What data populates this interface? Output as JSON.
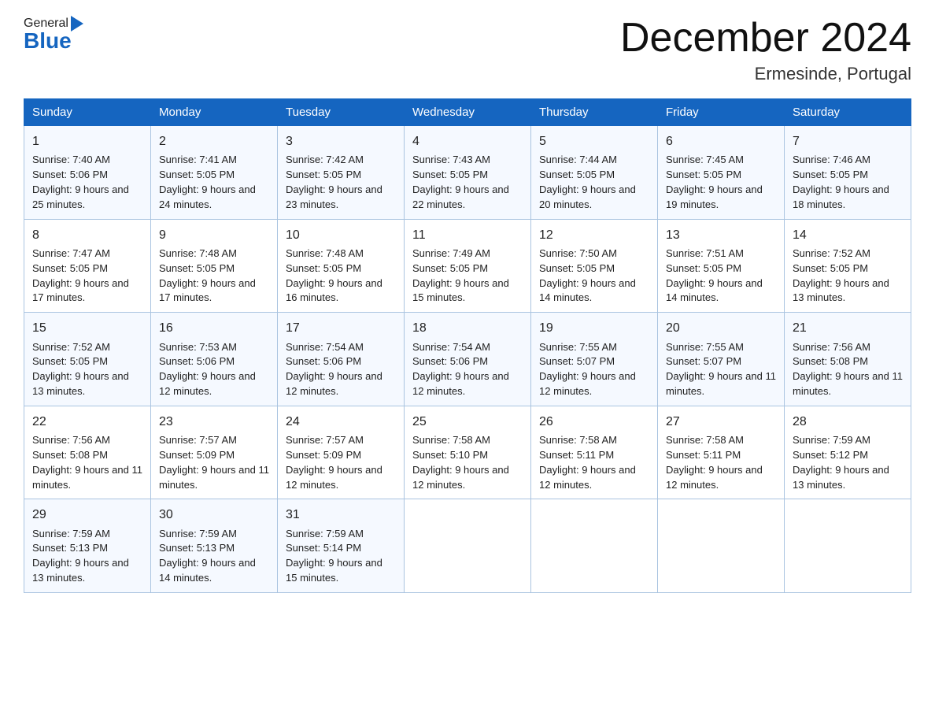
{
  "header": {
    "logo_general": "General",
    "logo_blue": "Blue",
    "month_title": "December 2024",
    "location": "Ermesinde, Portugal"
  },
  "days_of_week": [
    "Sunday",
    "Monday",
    "Tuesday",
    "Wednesday",
    "Thursday",
    "Friday",
    "Saturday"
  ],
  "weeks": [
    [
      {
        "day": "1",
        "sunrise": "7:40 AM",
        "sunset": "5:06 PM",
        "daylight": "9 hours and 25 minutes."
      },
      {
        "day": "2",
        "sunrise": "7:41 AM",
        "sunset": "5:05 PM",
        "daylight": "9 hours and 24 minutes."
      },
      {
        "day": "3",
        "sunrise": "7:42 AM",
        "sunset": "5:05 PM",
        "daylight": "9 hours and 23 minutes."
      },
      {
        "day": "4",
        "sunrise": "7:43 AM",
        "sunset": "5:05 PM",
        "daylight": "9 hours and 22 minutes."
      },
      {
        "day": "5",
        "sunrise": "7:44 AM",
        "sunset": "5:05 PM",
        "daylight": "9 hours and 20 minutes."
      },
      {
        "day": "6",
        "sunrise": "7:45 AM",
        "sunset": "5:05 PM",
        "daylight": "9 hours and 19 minutes."
      },
      {
        "day": "7",
        "sunrise": "7:46 AM",
        "sunset": "5:05 PM",
        "daylight": "9 hours and 18 minutes."
      }
    ],
    [
      {
        "day": "8",
        "sunrise": "7:47 AM",
        "sunset": "5:05 PM",
        "daylight": "9 hours and 17 minutes."
      },
      {
        "day": "9",
        "sunrise": "7:48 AM",
        "sunset": "5:05 PM",
        "daylight": "9 hours and 17 minutes."
      },
      {
        "day": "10",
        "sunrise": "7:48 AM",
        "sunset": "5:05 PM",
        "daylight": "9 hours and 16 minutes."
      },
      {
        "day": "11",
        "sunrise": "7:49 AM",
        "sunset": "5:05 PM",
        "daylight": "9 hours and 15 minutes."
      },
      {
        "day": "12",
        "sunrise": "7:50 AM",
        "sunset": "5:05 PM",
        "daylight": "9 hours and 14 minutes."
      },
      {
        "day": "13",
        "sunrise": "7:51 AM",
        "sunset": "5:05 PM",
        "daylight": "9 hours and 14 minutes."
      },
      {
        "day": "14",
        "sunrise": "7:52 AM",
        "sunset": "5:05 PM",
        "daylight": "9 hours and 13 minutes."
      }
    ],
    [
      {
        "day": "15",
        "sunrise": "7:52 AM",
        "sunset": "5:05 PM",
        "daylight": "9 hours and 13 minutes."
      },
      {
        "day": "16",
        "sunrise": "7:53 AM",
        "sunset": "5:06 PM",
        "daylight": "9 hours and 12 minutes."
      },
      {
        "day": "17",
        "sunrise": "7:54 AM",
        "sunset": "5:06 PM",
        "daylight": "9 hours and 12 minutes."
      },
      {
        "day": "18",
        "sunrise": "7:54 AM",
        "sunset": "5:06 PM",
        "daylight": "9 hours and 12 minutes."
      },
      {
        "day": "19",
        "sunrise": "7:55 AM",
        "sunset": "5:07 PM",
        "daylight": "9 hours and 12 minutes."
      },
      {
        "day": "20",
        "sunrise": "7:55 AM",
        "sunset": "5:07 PM",
        "daylight": "9 hours and 11 minutes."
      },
      {
        "day": "21",
        "sunrise": "7:56 AM",
        "sunset": "5:08 PM",
        "daylight": "9 hours and 11 minutes."
      }
    ],
    [
      {
        "day": "22",
        "sunrise": "7:56 AM",
        "sunset": "5:08 PM",
        "daylight": "9 hours and 11 minutes."
      },
      {
        "day": "23",
        "sunrise": "7:57 AM",
        "sunset": "5:09 PM",
        "daylight": "9 hours and 11 minutes."
      },
      {
        "day": "24",
        "sunrise": "7:57 AM",
        "sunset": "5:09 PM",
        "daylight": "9 hours and 12 minutes."
      },
      {
        "day": "25",
        "sunrise": "7:58 AM",
        "sunset": "5:10 PM",
        "daylight": "9 hours and 12 minutes."
      },
      {
        "day": "26",
        "sunrise": "7:58 AM",
        "sunset": "5:11 PM",
        "daylight": "9 hours and 12 minutes."
      },
      {
        "day": "27",
        "sunrise": "7:58 AM",
        "sunset": "5:11 PM",
        "daylight": "9 hours and 12 minutes."
      },
      {
        "day": "28",
        "sunrise": "7:59 AM",
        "sunset": "5:12 PM",
        "daylight": "9 hours and 13 minutes."
      }
    ],
    [
      {
        "day": "29",
        "sunrise": "7:59 AM",
        "sunset": "5:13 PM",
        "daylight": "9 hours and 13 minutes."
      },
      {
        "day": "30",
        "sunrise": "7:59 AM",
        "sunset": "5:13 PM",
        "daylight": "9 hours and 14 minutes."
      },
      {
        "day": "31",
        "sunrise": "7:59 AM",
        "sunset": "5:14 PM",
        "daylight": "9 hours and 15 minutes."
      },
      null,
      null,
      null,
      null
    ]
  ],
  "labels": {
    "sunrise": "Sunrise:",
    "sunset": "Sunset:",
    "daylight": "Daylight:"
  }
}
